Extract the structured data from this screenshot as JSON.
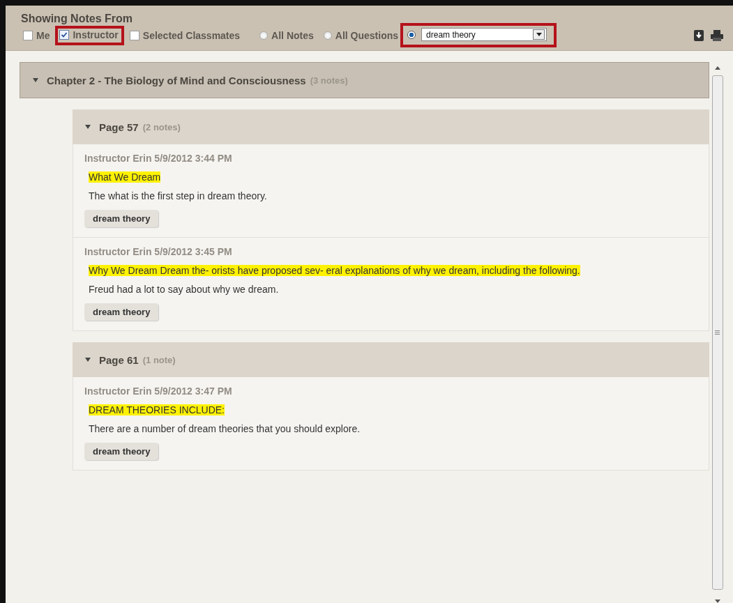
{
  "header": {
    "title": "Showing Notes From",
    "checkboxes": [
      {
        "label": "Me",
        "checked": false,
        "highlighted": false
      },
      {
        "label": "Instructor",
        "checked": true,
        "highlighted": true
      },
      {
        "label": "Selected Classmates",
        "checked": false,
        "highlighted": false
      }
    ],
    "filters": [
      {
        "kind": "radio",
        "label": "All Notes",
        "selected": false
      },
      {
        "kind": "radio",
        "label": "All Questions",
        "selected": false
      },
      {
        "kind": "select",
        "value": "dream theory",
        "selected": true
      }
    ]
  },
  "chapters": [
    {
      "title": "Chapter 2 - The Biology of Mind and Consciousness",
      "count": "(3 notes)",
      "expanded": true,
      "pages": [
        {
          "title": "Page 57",
          "count": "(2 notes)",
          "expanded": true,
          "notes": [
            {
              "meta": "Instructor Erin 5/9/2012 3:44 PM",
              "highlight": "What We Dream",
              "body": "The what is the first step in dream theory.",
              "tags": [
                "dream theory"
              ]
            },
            {
              "meta": "Instructor Erin 5/9/2012 3:45 PM",
              "highlight": "Why We Dream Dream the- orists have proposed sev- eral explanations of why we dream, including the following.",
              "body": "Freud had a lot to say about why we dream.",
              "tags": [
                "dream theory"
              ]
            }
          ]
        },
        {
          "title": "Page 61",
          "count": "(1 note)",
          "expanded": true,
          "notes": [
            {
              "meta": "Instructor Erin 5/9/2012 3:47 PM",
              "highlight": "DREAM THEORIES INCLUDE:",
              "body": "There are a number of dream theories that you should explore.",
              "tags": [
                "dream theory"
              ]
            }
          ]
        }
      ]
    }
  ]
}
